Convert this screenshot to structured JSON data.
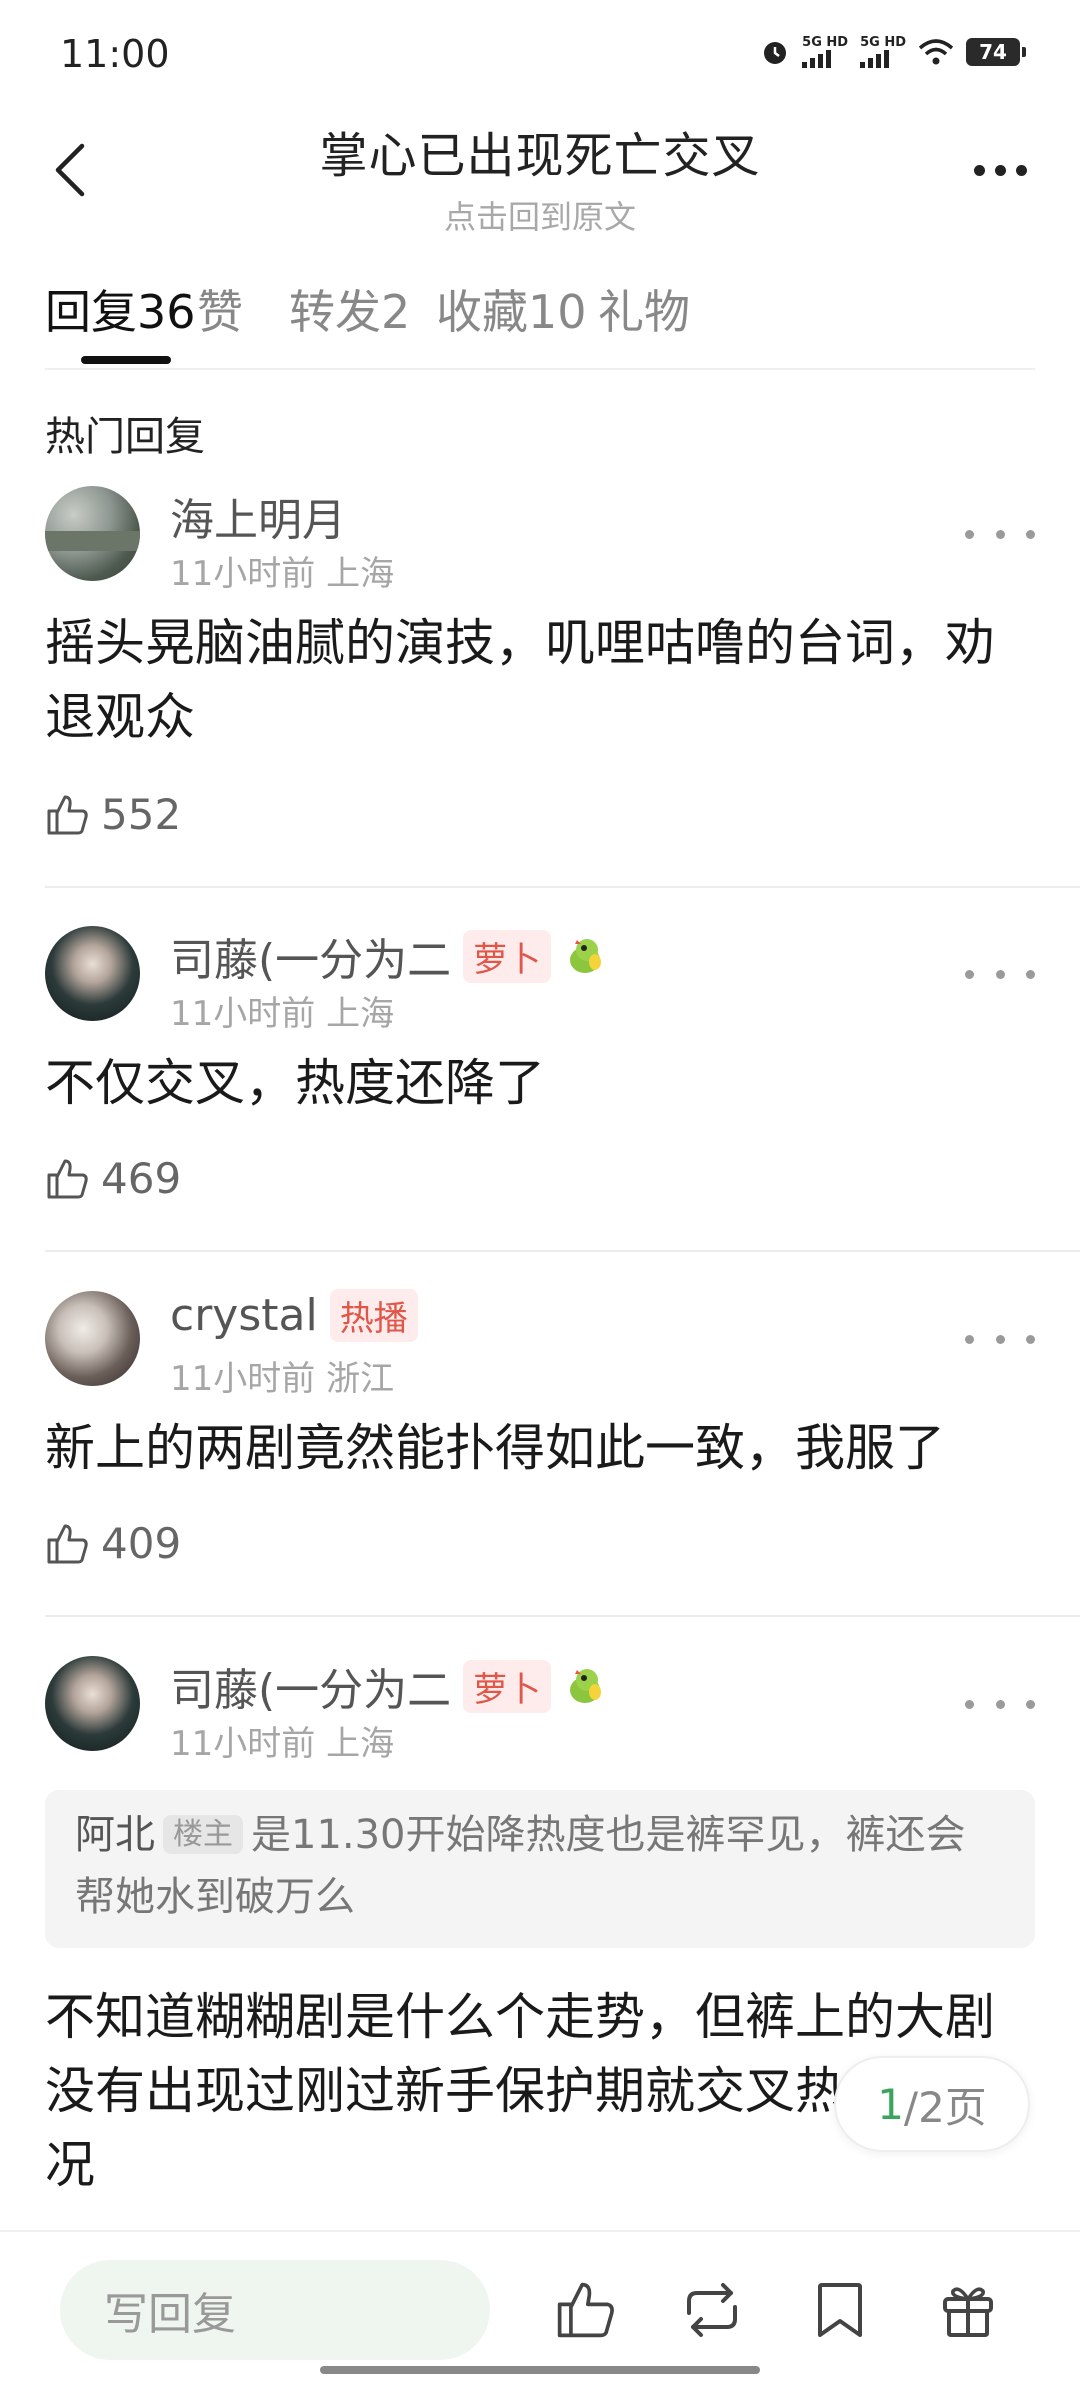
{
  "status_bar": {
    "time": "11:00",
    "network_1": "5G HD",
    "network_2": "5G HD",
    "battery": "74",
    "icons": [
      "alarm-icon",
      "signal-icon",
      "signal-icon",
      "wifi-icon",
      "battery-icon"
    ]
  },
  "header": {
    "title": "掌心已出现死亡交叉",
    "subtitle": "点击回到原文"
  },
  "tabs": [
    {
      "label": "回复",
      "count": "36",
      "active": true
    },
    {
      "label": "赞",
      "count": ""
    },
    {
      "label": "转发",
      "count": "2"
    },
    {
      "label": "收藏",
      "count": "10"
    },
    {
      "label": "礼物",
      "count": ""
    }
  ],
  "section_title": "热门回复",
  "comments": [
    {
      "username": "海上明月",
      "badge": "",
      "time": "11小时前",
      "location": "上海",
      "text": "摇头晃脑油腻的演技，叽哩咕噜的台词，劝退观众",
      "likes": "552"
    },
    {
      "username": "司藤(一分为二",
      "badge": "萝卜",
      "time": "11小时前",
      "location": "上海",
      "text": "不仅交叉，热度还降了",
      "likes": "469"
    },
    {
      "username": "crystal",
      "badge": "热播",
      "time": "11小时前",
      "location": "浙江",
      "text": "新上的两剧竟然能扑得如此一致，我服了",
      "likes": "409"
    },
    {
      "username": "司藤(一分为二",
      "badge": "萝卜",
      "time": "11小时前",
      "location": "上海",
      "quote": {
        "author": "阿北",
        "author_badge": "楼主",
        "text": "是11.30开始降热度也是裤罕见，裤还会帮她水到破万么"
      },
      "text": "不知道糊糊剧是什么个走势，但裤上的大剧没有出现过刚过新手保护期就交叉热度的情况"
    }
  ],
  "pagination": {
    "current": "1",
    "total": "/2页"
  },
  "bottom_bar": {
    "reply_placeholder": "写回复",
    "icons": [
      "like-icon",
      "repost-icon",
      "bookmark-icon",
      "gift-icon"
    ]
  },
  "colors": {
    "accent_green": "#3aa55c",
    "badge_red": "#e0574a",
    "badge_bg": "#fdeceb",
    "reply_input_bg": "#eff6f0"
  }
}
